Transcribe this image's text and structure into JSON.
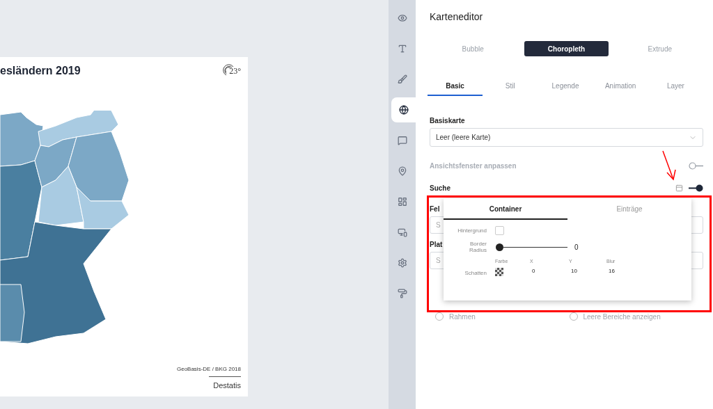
{
  "map_card": {
    "title": "esländern 2019",
    "logo_text": "23°",
    "source": "GeoBasis-DE / BKG 2018",
    "credit": "Destatis"
  },
  "sidebar": {
    "items": [
      {
        "kind": "eye",
        "selected": false
      },
      {
        "kind": "type",
        "selected": false
      },
      {
        "kind": "brush",
        "selected": false
      },
      {
        "kind": "globe",
        "selected": true
      },
      {
        "kind": "comment",
        "selected": false
      },
      {
        "kind": "pin",
        "selected": false
      },
      {
        "kind": "layout",
        "selected": false
      },
      {
        "kind": "devices",
        "selected": false
      },
      {
        "kind": "settings",
        "selected": false
      },
      {
        "kind": "roller",
        "selected": false
      }
    ]
  },
  "editor": {
    "title": "Karteneditor",
    "modes": [
      {
        "label": "Bubble",
        "selected": false
      },
      {
        "label": "Choropleth",
        "selected": true
      },
      {
        "label": "Extrude",
        "selected": false
      }
    ],
    "tabs": [
      {
        "label": "Basic",
        "selected": true
      },
      {
        "label": "Stil",
        "selected": false
      },
      {
        "label": "Legende",
        "selected": false
      },
      {
        "label": "Animation",
        "selected": false
      },
      {
        "label": "Layer",
        "selected": false
      }
    ],
    "basemap": {
      "label": "Basiskarte",
      "value": "Leer (leere Karte)"
    },
    "toggles": [
      {
        "label": "Ansichtsfenster anpassen",
        "on": false,
        "disabled": true,
        "settings_icon": false
      },
      {
        "label": "Suche",
        "on": true,
        "disabled": false,
        "settings_icon": true
      }
    ],
    "field_label": "Fel",
    "field_value": "S",
    "placeholder_label": "Plat",
    "placeholder_value": "S",
    "radios": [
      {
        "label": "Rahmen",
        "selected": false
      },
      {
        "label": "Leere Bereiche anzeigen",
        "selected": false
      }
    ]
  },
  "popup": {
    "tabs": [
      {
        "label": "Container",
        "selected": true
      },
      {
        "label": "Einträge",
        "selected": false
      }
    ],
    "background": {
      "label": "Hintergrund",
      "checked": false
    },
    "border_radius": {
      "label": "Border Radius",
      "level": 0,
      "reading": "0"
    },
    "shadow": {
      "label": "Schatten",
      "columns": [
        "Farbe",
        "X",
        "Y",
        "Blur"
      ],
      "values": [
        "0",
        "10",
        "16"
      ]
    }
  }
}
